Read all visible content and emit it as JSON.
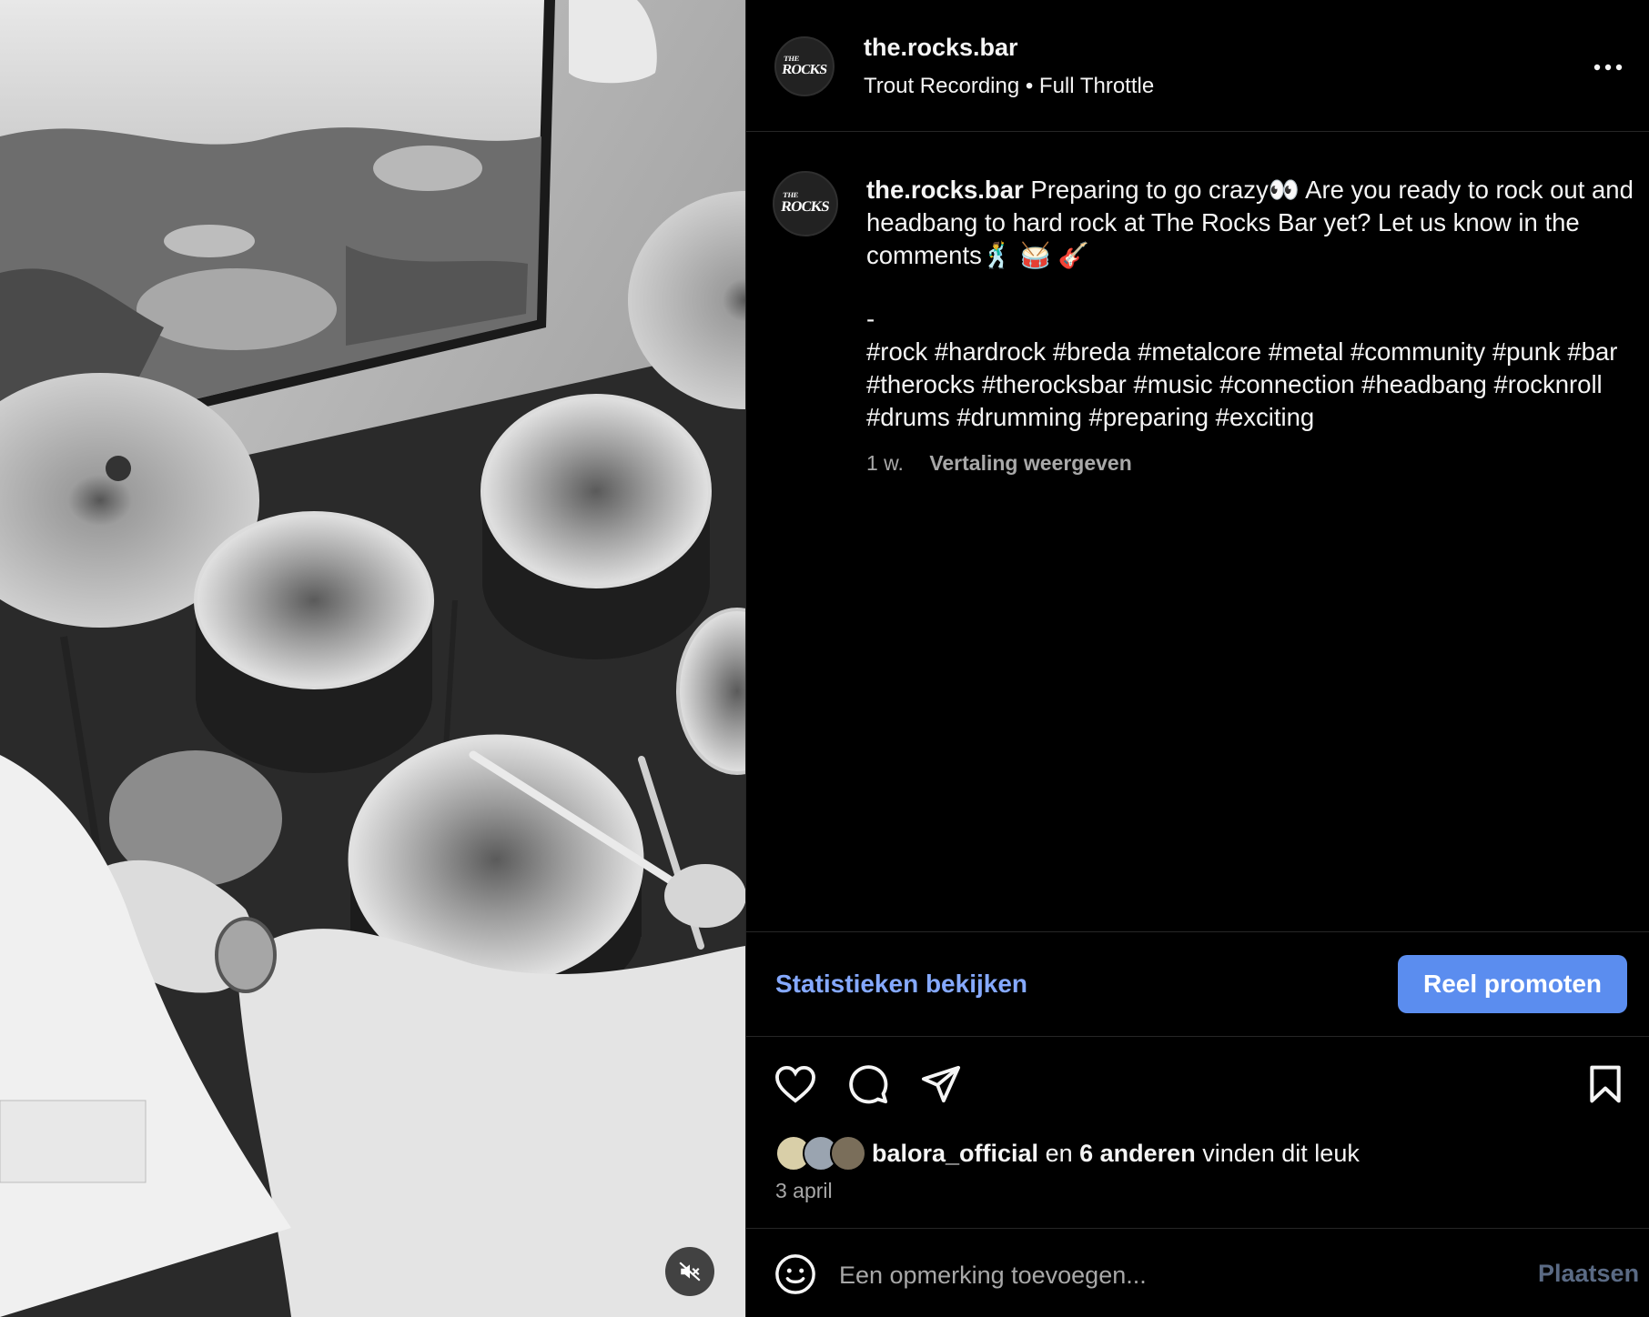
{
  "post": {
    "username": "the.rocks.bar",
    "audio": "Trout Recording • Full Throttle",
    "avatar_text_top": "THE",
    "avatar_text_main": "ROCKS",
    "caption_line1": "Preparing to go crazy👀 Are you ready to rock out and headbang to hard rock at The Rocks Bar yet? Let us know in the comments🕺 🥁 🎸",
    "caption_dash": "-",
    "caption_tags": "#rock #hardrock #breda #metalcore #metal #community #punk #bar #therocks #therocksbar #music #connection #headbang #rocknroll #drums #drumming #preparing #exciting",
    "time_ago": "1 w.",
    "translate_label": "Vertaling weergeven"
  },
  "actions": {
    "stats_label": "Statistieken bekijken",
    "promote_label": "Reel promoten"
  },
  "likes": {
    "first_user": "balora_official",
    "connector": "en",
    "others": "6 anderen",
    "suffix": "vinden dit leuk"
  },
  "date": "3 april",
  "comment": {
    "placeholder": "Een opmerking toevoegen...",
    "post_label": "Plaatsen"
  },
  "colors": {
    "link": "#85a9ff",
    "button": "#5b8def",
    "muted": "#a8a8a8"
  },
  "icons": [
    "more-options-icon",
    "heart-icon",
    "comment-icon",
    "share-icon",
    "bookmark-icon",
    "emoji-icon",
    "muted-speaker-icon"
  ]
}
